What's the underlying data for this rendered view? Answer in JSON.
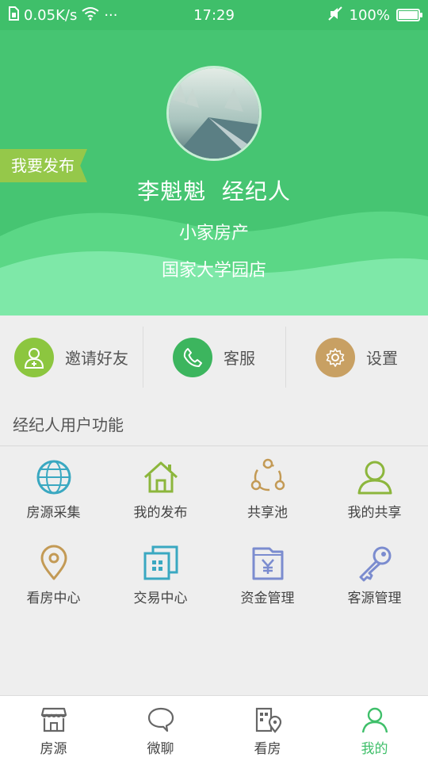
{
  "status_bar": {
    "network_speed": "0.05K/s",
    "dots": "···",
    "time": "17:29",
    "battery_text": "100%",
    "battery_level": 1.0
  },
  "header": {
    "publish_tag": "我要发布",
    "name": "李魁魁",
    "role": "经纪人",
    "company": "小家房产",
    "store": "国家大学园店"
  },
  "quick_actions": [
    {
      "label": "邀请好友",
      "icon": "invite-friend-icon",
      "color": "#8cc63f"
    },
    {
      "label": "客服",
      "icon": "phone-icon",
      "color": "#3cb55e"
    },
    {
      "label": "设置",
      "icon": "gear-icon",
      "color": "#c8a063"
    }
  ],
  "section": {
    "title": "经纪人用户功能"
  },
  "features": [
    {
      "label": "房源采集",
      "icon": "globe-icon",
      "color": "#3aa8c1"
    },
    {
      "label": "我的发布",
      "icon": "house-icon",
      "color": "#8cb63c"
    },
    {
      "label": "共享池",
      "icon": "share-icon",
      "color": "#c39a55"
    },
    {
      "label": "我的共享",
      "icon": "person-icon",
      "color": "#8cb63c"
    },
    {
      "label": "看房中心",
      "icon": "location-pin-icon",
      "color": "#c39a55"
    },
    {
      "label": "交易中心",
      "icon": "building-icon",
      "color": "#3aa8c1"
    },
    {
      "label": "资金管理",
      "icon": "yen-folder-icon",
      "color": "#7b8ccf"
    },
    {
      "label": "客源管理",
      "icon": "key-icon",
      "color": "#7b8ccf"
    }
  ],
  "tabs": [
    {
      "label": "房源",
      "icon": "store-icon",
      "active": false
    },
    {
      "label": "微聊",
      "icon": "chat-bubble-icon",
      "active": false
    },
    {
      "label": "看房",
      "icon": "map-building-icon",
      "active": false
    },
    {
      "label": "我的",
      "icon": "profile-icon",
      "active": true
    }
  ],
  "colors": {
    "brand_green": "#3fbf6a",
    "wave_light": "#7ee8a8"
  }
}
